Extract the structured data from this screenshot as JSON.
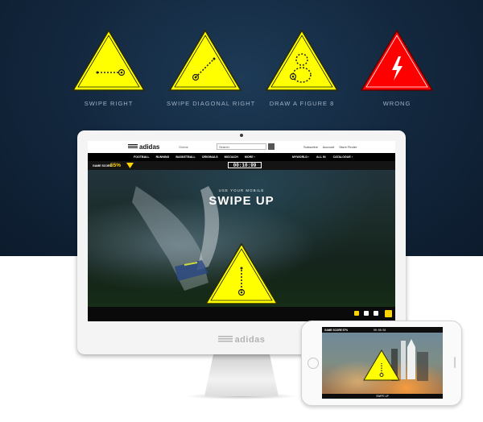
{
  "gestures": [
    {
      "label": "SWIPE RIGHT",
      "icon": "swipe-right-icon",
      "color": "#ffff00",
      "kind": "right"
    },
    {
      "label": "SWIPE DIAGONAL RIGHT",
      "icon": "swipe-diagonal-icon",
      "color": "#ffff00",
      "kind": "diagonal"
    },
    {
      "label": "DRAW A FIGURE 8",
      "icon": "figure-eight-icon",
      "color": "#ffff00",
      "kind": "eight"
    },
    {
      "label": "WRONG",
      "icon": "lightning-bolt-icon",
      "color": "#ff0000",
      "kind": "wrong"
    }
  ],
  "desktop": {
    "brand": "adidas",
    "region": "Global",
    "search_placeholder": "Search",
    "top_links": [
      "Subscribe",
      "Account",
      "Store Finder"
    ],
    "nav_left": [
      "FOOTBALL",
      "RUNNING",
      "BASKETBALL",
      "ORIGINALS",
      "MICOACH",
      "MORE ›"
    ],
    "nav_right": [
      "MYWORLD ›",
      "ALL IN",
      "CATALOGUE ›"
    ],
    "score_label": "GAME SCORE",
    "score_value": "55%",
    "timer": "00:10:99",
    "subheading": "USE YOUR MOBILE",
    "title": "SWIPE UP",
    "chin_logo": "adidas"
  },
  "phone": {
    "score_label": "GAME SCORE 57%",
    "timer": "00:08:56",
    "caption": "SWIPE UP"
  },
  "colors": {
    "accent": "#ffff00",
    "wrong": "#ff0000",
    "background": "#12263c"
  }
}
